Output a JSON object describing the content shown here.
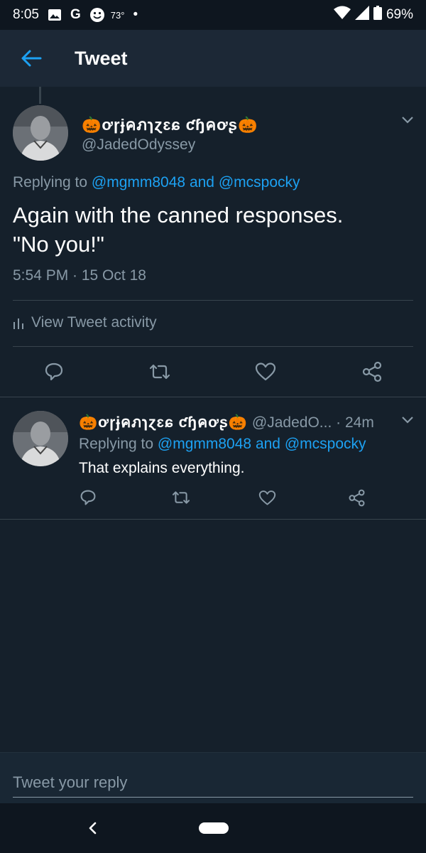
{
  "status_bar": {
    "time": "8:05",
    "icons": [
      "image-icon",
      "google-icon",
      "smiley-icon"
    ],
    "google_letter": "G",
    "temperature": "73°",
    "dot": "•",
    "battery": "69%"
  },
  "app_bar": {
    "title": "Tweet"
  },
  "main_tweet": {
    "display_name": "🎃ơɼɉคภɿɀɛɕ ƈɧคơʂ🎃",
    "handle": "@JadedOdyssey",
    "replying_prefix": "Replying to",
    "replying_user1": "@mgmm8048",
    "replying_and": "and",
    "replying_user2": "@mcspocky",
    "text_line1": "Again with the canned responses.",
    "text_line2": "\"No you!\"",
    "timestamp": "5:54 PM · 15 Oct 18",
    "activity": "View Tweet activity"
  },
  "reply_tweet": {
    "display_name": "🎃ơɼɉคภɿɀɛɕ ƈɧคơʂ🎃",
    "handle_time": "@JadedO...  · 24m",
    "replying_prefix": "Replying to",
    "replying_user1": "@mgmm8048",
    "replying_and": "and",
    "replying_user2": "@mcspocky",
    "text": "That explains everything."
  },
  "reply_box": {
    "placeholder": "Tweet your reply"
  },
  "colors": {
    "background": "#15202b",
    "app_bar": "#1c2836",
    "accent": "#1da1f2",
    "secondary_text": "#8899a6",
    "divider": "#38444d"
  }
}
